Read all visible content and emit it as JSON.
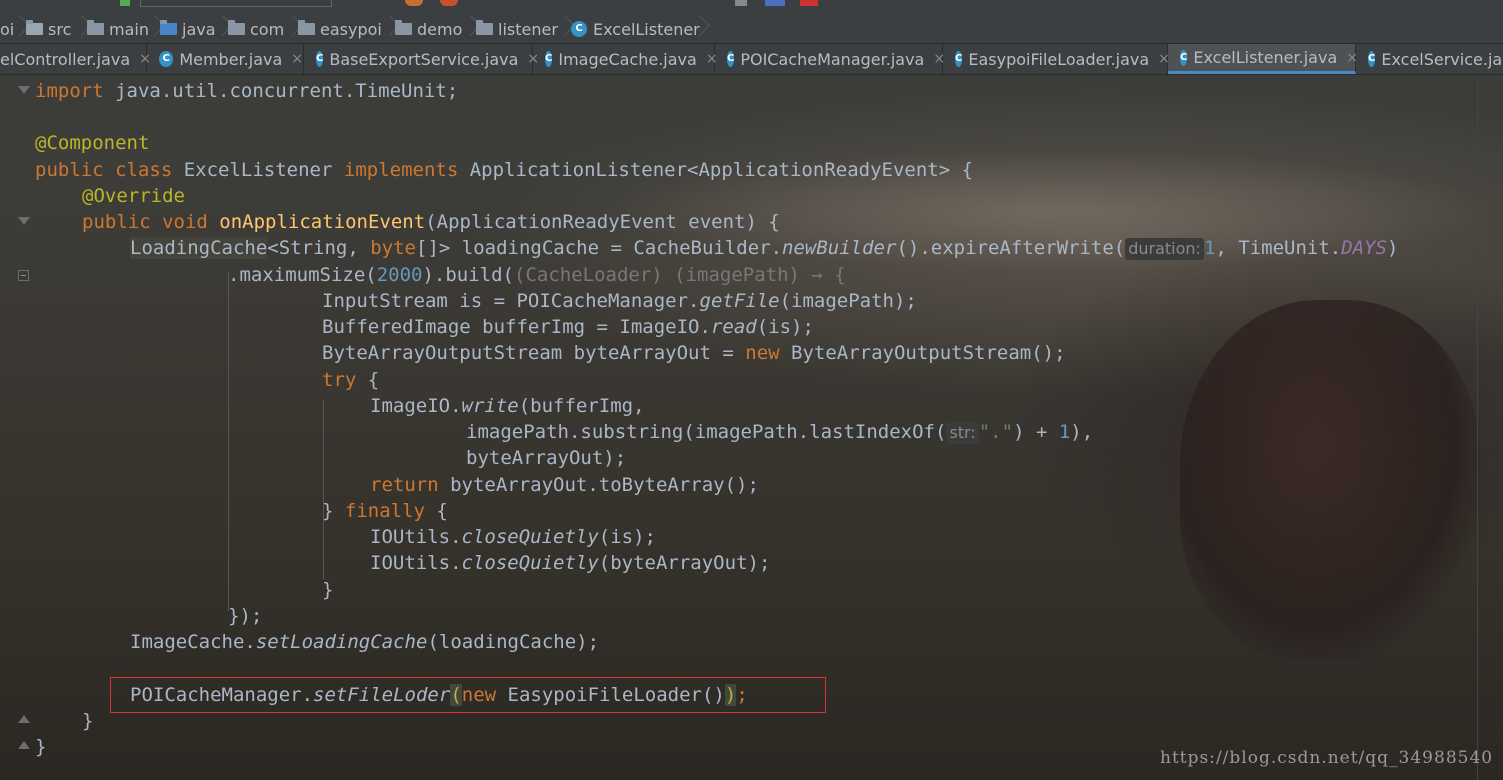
{
  "breadcrumb": {
    "items": [
      {
        "label": "oi",
        "icon": "none"
      },
      {
        "label": "src",
        "icon": "folder-icon"
      },
      {
        "label": "main",
        "icon": "folder-icon"
      },
      {
        "label": "java",
        "icon": "folder-icon"
      },
      {
        "label": "com",
        "icon": "package-icon"
      },
      {
        "label": "easypoi",
        "icon": "package-icon"
      },
      {
        "label": "demo",
        "icon": "package-icon"
      },
      {
        "label": "listener",
        "icon": "package-icon"
      },
      {
        "label": "ExcelListener",
        "icon": "class-icon"
      }
    ]
  },
  "tabs": [
    {
      "label": "elController.java",
      "icon": "none",
      "active": false
    },
    {
      "label": "Member.java",
      "icon": "class-icon",
      "active": false
    },
    {
      "label": "BaseExportService.java",
      "icon": "class-lock-icon",
      "active": false
    },
    {
      "label": "ImageCache.java",
      "icon": "class-lock-icon",
      "active": false
    },
    {
      "label": "POICacheManager.java",
      "icon": "class-lock-icon",
      "active": false
    },
    {
      "label": "EasypoiFileLoader.java",
      "icon": "class-icon",
      "active": false
    },
    {
      "label": "ExcelListener.java",
      "icon": "class-icon",
      "active": true
    },
    {
      "label": "ExcelService.java",
      "icon": "class-icon",
      "active": false
    }
  ],
  "tab_close": "×",
  "colors": {
    "keyword": "#cc7832",
    "annotation": "#bbb529",
    "method": "#ffc66d",
    "number": "#6897bb",
    "string": "#6a8759",
    "highlight_box": "#dd3333",
    "active_tab_underline": "#4a88c7"
  },
  "code": {
    "l1": {
      "a": "import",
      "b": " java.util.concurrent.TimeUnit;"
    },
    "l2": {
      "a": "@Component"
    },
    "l3": {
      "a": "public class",
      "b": " ExcelListener ",
      "c": "implements",
      "d": " ApplicationListener<ApplicationReadyEvent> {"
    },
    "l4": {
      "a": "@Override"
    },
    "l5": {
      "a": "public void ",
      "b": "onApplicationEvent",
      "c": "(ApplicationReadyEvent event) {"
    },
    "l6": {
      "a": "LoadingCache",
      "b": "<String, ",
      "c": "byte",
      "d": "[]> loadingCache = CacheBuilder.",
      "e": "newBuilder",
      "f": "().expireAfterWrite(",
      "hint": "duration:",
      "g": "1",
      "h": ", TimeUnit.",
      "i": "DAYS",
      "j": ")"
    },
    "l7": {
      "a": ".maximumSize(",
      "b": "2000",
      "c": ").build(",
      "d": "(CacheLoader) (imagePath) → {"
    },
    "l8": {
      "a": "InputStream is = POICacheManager.",
      "b": "getFile",
      "c": "(imagePath);"
    },
    "l9": {
      "a": "BufferedImage bufferImg = ImageIO.",
      "b": "read",
      "c": "(is);"
    },
    "l10": {
      "a": "ByteArrayOutputStream byteArrayOut = ",
      "b": "new",
      "c": " ByteArrayOutputStream();"
    },
    "l11": {
      "a": "try",
      "b": " {"
    },
    "l12": {
      "a": "ImageIO.",
      "b": "write",
      "c": "(bufferImg,"
    },
    "l13": {
      "a": "imagePath.substring(imagePath.lastIndexOf(",
      "hint": "str:",
      "b": "\".\"",
      "c": ") + ",
      "d": "1",
      "e": "),"
    },
    "l14": {
      "a": "byteArrayOut);"
    },
    "l15": {
      "a": "return",
      "b": " byteArrayOut.toByteArray();"
    },
    "l16": {
      "a": "} ",
      "b": "finally",
      "c": " {"
    },
    "l17": {
      "a": "IOUtils.",
      "b": "closeQuietly",
      "c": "(is);"
    },
    "l18": {
      "a": "IOUtils.",
      "b": "closeQuietly",
      "c": "(byteArrayOut);"
    },
    "l19": {
      "a": "}"
    },
    "l20": {
      "a": "});"
    },
    "l21": {
      "a": "ImageCache.",
      "b": "setLoadingCache",
      "c": "(loadingCache);"
    },
    "l22": {
      "a": "POICacheManager.",
      "b": "setFileLoder",
      "c": "(",
      "d": "new",
      "e": " EasypoiFileLoader()",
      "f": ")",
      "g": ";"
    },
    "l23": {
      "a": "}"
    },
    "l24": {
      "a": "}"
    },
    "top_partial": "     ,     ,     ,     "
  },
  "watermark": "https://blog.csdn.net/qq_34988540"
}
